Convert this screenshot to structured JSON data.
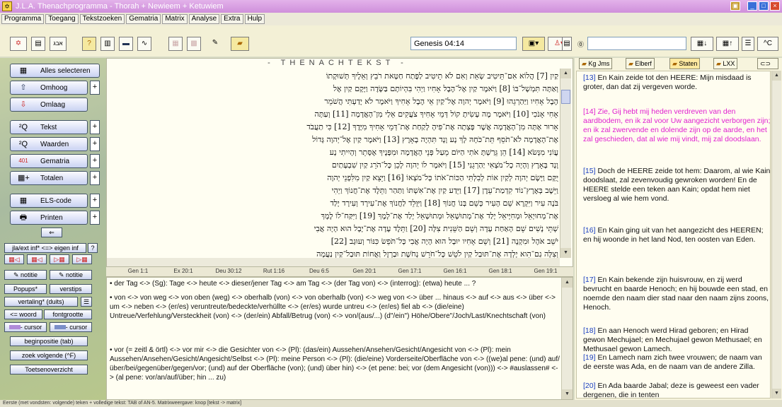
{
  "window": {
    "title": "J.L.A. Thenachprogramma - Thorah + Newieem + Ketuwiem"
  },
  "menu": [
    "Programma",
    "Toegang",
    "Tekstzoeken",
    "Gematria",
    "Matrix",
    "Analyse",
    "Extra",
    "Hulp"
  ],
  "toolbar": {
    "reference": "Genesis 04:14"
  },
  "left": {
    "buttons": [
      {
        "icon": "select-all-icon",
        "label": "Alles selecteren"
      },
      {
        "icon": "arrow-up-icon",
        "label": "Omhoog"
      },
      {
        "icon": "arrow-down-icon",
        "label": "Omlaag"
      },
      {
        "icon": "text-icon",
        "label": "Tekst"
      },
      {
        "icon": "values-icon",
        "label": "Waarden"
      },
      {
        "icon": "gematria-icon",
        "label": "Gematria"
      },
      {
        "icon": "totals-icon",
        "label": "Totalen"
      },
      {
        "icon": "els-icon",
        "label": "ELS-code"
      },
      {
        "icon": "printer-icon",
        "label": "Printen"
      }
    ],
    "small": {
      "ext": "jla/ext inf* <=> eigen inf",
      "q": "?",
      "notitie1": "notitie",
      "notitie2": "notitie",
      "popups": "Popups*",
      "verstips": "verstips",
      "vertaling": "vertaling* (duits)",
      "woord": "<= woord",
      "fontgrootte": "fontgrootte",
      "cursor1": "- cursor",
      "cursor2": "- cursor",
      "beginpositie": "beginpositie (tab)",
      "zoek": "zoek volgende (^F)",
      "toetsen": "Toetsenoverzicht"
    }
  },
  "hebrew": {
    "header": "- THENACHTEKST -",
    "lines": [
      "קַיִן [7] הֲלוֹא אִם־תֵּיטִיב שְׂאֵת וְאִם לֹא תֵיטִיב לַפֶּתַח חַטָּאת רֹבֵץ וְאֵלֶיךָ תְּשׁוּקָתוֹ",
      "וְאַתָּה תִּמְשָׁל־בּוֹ [8] וַיֹּאמֶר קַיִן אֶל־הֶבֶל אָחִיו וַיְהִי בִּהְיוֹתָם בַּשָּׂדֶה וַיָּקָם קַיִן אֶל",
      "הֶבֶל אָחִיו וַיַּהַרְגֵהוּ [9] וַיֹּאמֶר יְהוָה אֶל־קַיִן אֵי הֶבֶל אָחִיךָ וַיֹּאמֶר לֹא יָדַעְתִּי הֲשֹׁמֵר",
      "אָחִי אָנֹכִי [10] וַיֹּאמֶר מֶה עָשִׂיתָ קוֹל דְּמֵי אָחִיךָ צֹעֲקִים אֵלַי מִן־הָאֲדָמָה [11] וְעַתָּה",
      "אָרוּר אָתָּה מִן־הָאֲדָמָה אֲשֶׁר פָּצְתָה אֶת־פִּיהָ לָקַחַת אֶת־דְּמֵי אָחִיךָ מִיָּדֶךָ [12] כִּי תַעֲבֹד",
      "אֶת־הָאֲדָמָה לֹא־תֹסֵף תֵּת־כֹּחָהּ לָךְ נָע וָנָד תִּהְיֶה בָאָרֶץ [13] וַיֹּאמֶר קַיִן אֶל־יְהוָה גָּדוֹל",
      "עֲוֹנִי מִנְּשֹׂא [14] הֵן גֵּרַשְׁתָּ אֹתִי הַיּוֹם מֵעַל פְּנֵי הָאֲדָמָה וּמִפָּנֶיךָ אֶסָּתֵר וְהָיִיתִי נָע",
      "וָנָד בָּאָרֶץ וְהָיָה כָל־מֹצְאִי יַהַרְגֵנִי [15] וַיֹּאמֶר לוֹ יְהוָה לָכֵן כָּל־הֹרֵג קַיִן שִׁבְעָתַיִם",
      "יֻקָּם וַיָּשֶׂם יְהוָה לְקַיִן אוֹת לְבִלְתִּי הַכּוֹת־אֹתוֹ כָּל־מֹצְאוֹ [16] וַיֵּצֵא קַיִן מִלִּפְנֵי יְהוָה",
      "וַיֵּשֶׁב בְּאֶרֶץ־נוֹד קִדְמַת־עֵדֶן [17] וַיֵּדַע קַיִן אֶת־אִשְׁתּוֹ וַתַּהַר וַתֵּלֶד אֶת־חֲנוֹךְ וַיְהִי",
      "בֹּנֶה עִיר וַיִּקְרָא שֵׁם הָעִיר כְּשֵׁם בְּנוֹ חֲנוֹךְ [18] וַיִּוָּלֵד לַחֲנוֹךְ אֶת־עִירָד וְעִירָד יָלַד",
      "אֶת־מְחוּיָאֵל וּמְחִיָּיאֵל יָלַד אֶת־מְתוּשָׁאֵל וּמְתוּשָׁאֵל יָלַד אֶת־לָמֶךְ [19] וַיִּקַּח־לוֹ לֶמֶךְ",
      "שְׁתֵּי נָשִׁים שֵׁם הָאַחַת עָדָה וְשֵׁם הַשֵּׁנִית צִלָּה [20] וַתֵּלֶד עָדָה אֶת־יָבָל הוּא הָיָה אֲבִי",
      "יֹשֵׁב אֹהֶל וּמִקְנֶה [21] וְשֵׁם אָחִיו יוּבָל הוּא הָיָה אֲבִי כָּל־תֹּפֵשׂ כִּנּוֹר וְעוּגָב [22]",
      "וְצִלָּה גַם־הִוא יָלְדָה אֶת־תּוּבַל קַיִן לֹטֵשׁ כָּל־חֹרֵשׁ נְחֹשֶׁת וּבַרְזֶל וַאֲחוֹת תּוּבַל־קַיִן נַעֲמָה"
    ]
  },
  "tabs": [
    "Gen 1:1",
    "Ex 20:1",
    "Deu 30:12",
    "Rut 1:16",
    "Deu 6:5",
    "Gen 20:1",
    "Gen 17:1",
    "Gen 16:1",
    "Gen 18:1",
    "Gen 19:1"
  ],
  "dict": [
    {
      "text": "der Tag <-> (Sg): Tage <-> heute <-> dieser/jener Tag <-> am Tag <-> (der Tag von) <-> (interrog): (etwa) heute ... ?"
    },
    {
      "text": "von <-> von weg <-> von oben (weg) <-> oberhalb (von) <-> von oberhalb (von) <-> weg von <-> über ... hinaus <-> auf <-> aus <-> über <-> um <-> neben <-> (er/es) veruntreute/bedeckte/verhüllte <-> (er/es) wurde untreu <-> (er/es) fiel ab <-> (die/eine) Untreue/Verfehlung/Versteckheit (von) <-> (der/ein) Abfall/Betrug (von) <-> von/(aus/...) (d\"/ein\") Höhe/Obere\"/Joch/Last/Knechtschaft (von)"
    },
    {
      "text": "vor (= zeitl & örtl) <-> vor mir <-> die Gesichter von <-> (Pl): (das/ein) Aussehen/Ansehen/Gesicht/Angesicht von <-> (Pl): mein Aussehen/Ansehen/Gesicht/Angesicht/Selbst <-> (Pl): meine Person <-> (Pl): (die/eine) Vorderseite/Oberfläche von <-> ((we)al pene: (und) auf/über/bei/gegenüber/gegen/vor; (und) auf der Oberfläche (von); (und) über hin) <-> (et pene: bei; vor (dem Angesicht (von))) <-> #auslassen# <-> (al pene: vor/an/auf/über; hin ... zu)"
    }
  ],
  "right": {
    "tabs": [
      "Kg Jms",
      "Elberf",
      "Staten",
      "LXX"
    ],
    "verses": [
      {
        "num": "[13]",
        "text": "En Kain zeide tot den HEERE: Mijn misdaad is groter, dan dat zij vergeven worde."
      },
      {
        "num": "[14]",
        "text": "Zie, Gij hebt mij heden verdreven van den aardbodem, en ik zal voor Uw aangezicht verborgen zijn; en ik zal zwervende en dolende zijn op de aarde, en het zal geschieden, dat al wie mij vindt, mij zal doodslaan."
      },
      {
        "num": "[15]",
        "text": "Doch de HEERE zeide tot hem: Daarom, al wie Kain doodslaat, zal zevenvoudig gewroken worden! En de HEERE stelde een teken aan Kain; opdat hem niet versloeg al wie hem vond."
      },
      {
        "num": "[16]",
        "text": "En Kain ging uit van het aangezicht des HEEREN; en hij woonde in het land Nod, ten oosten van Eden."
      },
      {
        "num": "[17]",
        "text": "En Kain bekende zijn huisvrouw, en zij werd bevrucht en baarde Henoch; en hij bouwde een stad, en noemde den naam dier stad naar den naam zijns zoons, Henoch."
      },
      {
        "num": "[18]",
        "text": "En aan Henoch werd Hirad geboren; en Hirad gewon Mechujael; en Mechujael gewon Methusael; en Methusael gewon Lamech."
      },
      {
        "num": "[19]",
        "text": "En Lamech nam zich twee vrouwen; de naam van de eerste was Ada, en de naam van de andere Zilla."
      },
      {
        "num": "[20]",
        "text": "En Ada baarde Jabal; deze is geweest een vader dergenen, die in tenten"
      }
    ]
  },
  "status": "Eerste (met vondsten: volgende) teken + volledige tekst: TAB of AN-5. Matrixweergave: knop [tekst -> matrix]"
}
